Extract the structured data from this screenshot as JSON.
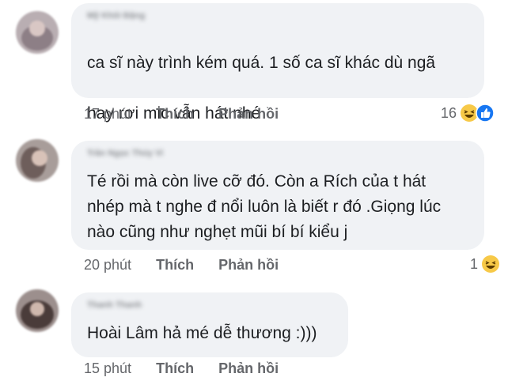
{
  "comments": [
    {
      "author": "Mỹ Khôi Đặng",
      "text_line1": "ca sĩ này trình kém quá. 1 số ca sĩ khác dù ngã",
      "text_line2": "hay rơi mic vẫn hát nhé",
      "inline_emojis": [
        "upside-down-face-icon",
        "upside-down-face-icon"
      ],
      "time": "17 phút",
      "like_label": "Thích",
      "reply_label": "Phản hồi",
      "reaction_count": "16",
      "reaction_icons": [
        "laughing-face-icon",
        "like-thumb-icon"
      ]
    },
    {
      "author": "Trần Ngọc Thúy Vi",
      "text": "Té rồi mà còn live cỡ đó. Còn a Rích của t hát\nnhép mà t nghe đ nổi luôn là biết r đó .Giọng lúc\nnào cũng như nghẹt mũi bí bí kiểu j",
      "time": "20 phút",
      "like_label": "Thích",
      "reply_label": "Phản hồi",
      "reaction_count": "1",
      "reaction_icons": [
        "laughing-face-icon"
      ]
    },
    {
      "author": "Thanh Thanh",
      "text": "Hoài Lâm hả mé dễ thương :)))",
      "time": "15 phút",
      "like_label": "Thích",
      "reply_label": "Phản hồi"
    }
  ],
  "colors": {
    "bubble_bg": "#f0f2f5",
    "text": "#1c1e21",
    "meta": "#65676b",
    "like_blue": "#1877f2",
    "emoji_yellow": "#f7c948"
  }
}
